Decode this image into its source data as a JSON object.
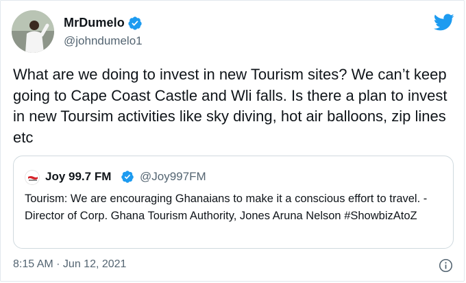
{
  "author": {
    "display_name": "MrDumelo",
    "handle": "@johndumelo1",
    "verified": true
  },
  "tweet": {
    "text": "What are we doing to invest in new Tourism sites? We can’t keep going to Cape Coast Castle and Wli falls. Is there a plan to invest in new Toursim activities like sky diving, hot air balloons, zip lines etc",
    "timestamp": "8:15 AM · Jun 12, 2021"
  },
  "quoted_tweet": {
    "display_name": "Joy 99.7 FM",
    "handle": "@Joy997FM",
    "verified": true,
    "text": "Tourism: We are encouraging Ghanaians to make it a conscious effort to travel. - Director of Corp. Ghana Tourism Authority, Jones Aruna Nelson #ShowbizAtoZ"
  },
  "icons": {
    "brand": "twitter-bird-icon",
    "verified": "verified-badge-icon",
    "info": "info-icon"
  },
  "colors": {
    "twitter_blue": "#1d9bf0",
    "text_primary": "#0f1419",
    "text_secondary": "#536471",
    "border": "#cfd9de",
    "joy_logo_red": "#d62128"
  }
}
